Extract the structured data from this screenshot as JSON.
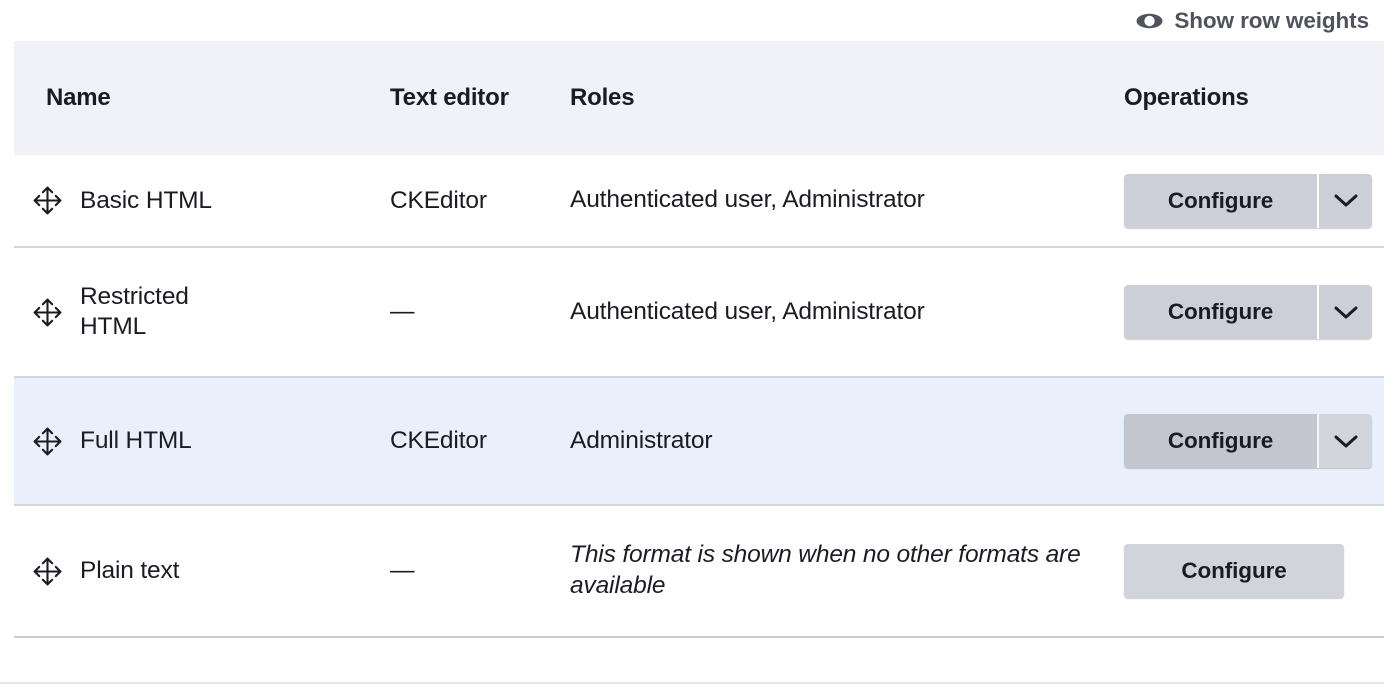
{
  "toolbar": {
    "row_weights_label": "Show row weights",
    "row_weights_icon": "eye-icon"
  },
  "table": {
    "columns": {
      "name": "Name",
      "text_editor": "Text editor",
      "roles": "Roles",
      "operations": "Operations"
    },
    "rows": [
      {
        "drag_icon": "move-arrows-icon",
        "name": "Basic HTML",
        "text_editor": "CKEditor",
        "roles": "Authenticated user, Administrator",
        "roles_italic": false,
        "configure_label": "Configure",
        "has_dropdown": true,
        "dropdown_icon": "chevron-down-icon",
        "highlighted": false
      },
      {
        "drag_icon": "move-arrows-icon",
        "name": "Restricted HTML",
        "text_editor": "—",
        "roles": "Authenticated user, Administrator",
        "roles_italic": false,
        "configure_label": "Configure",
        "has_dropdown": true,
        "dropdown_icon": "chevron-down-icon",
        "highlighted": false
      },
      {
        "drag_icon": "move-arrows-icon",
        "name": "Full HTML",
        "text_editor": "CKEditor",
        "roles": "Administrator",
        "roles_italic": false,
        "configure_label": "Configure",
        "has_dropdown": true,
        "dropdown_icon": "chevron-down-icon",
        "highlighted": true
      },
      {
        "drag_icon": "move-arrows-icon",
        "name": "Plain text",
        "text_editor": "—",
        "roles": "This format is shown when no other formats are available",
        "roles_italic": true,
        "configure_label": "Configure",
        "has_dropdown": false,
        "dropdown_icon": "",
        "highlighted": false
      }
    ]
  },
  "colors": {
    "header_background": "#f1f2f7",
    "row_highlight": "#eaf0fb",
    "text": "#1b1b24",
    "muted_text": "#50535e",
    "button_background": "#cdcfd8",
    "border": "#d4d6dd"
  }
}
